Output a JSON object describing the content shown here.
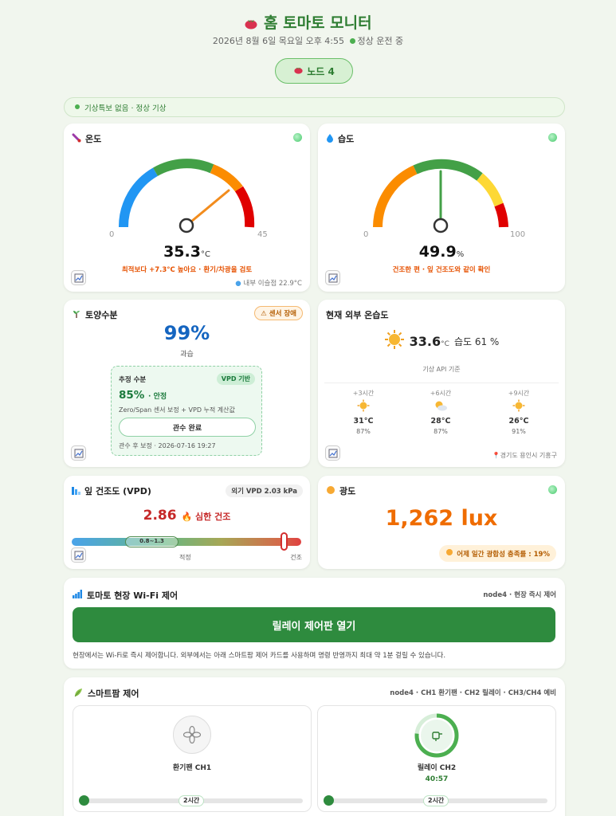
{
  "header": {
    "title": "홈 토마토 모니터",
    "datetime": "2026년 8월 6일 목요일 오후 4:55",
    "status": "정상 운전 중",
    "node_button": "노드 4"
  },
  "alert": {
    "text": "기상특보 없음 · 정상 기상"
  },
  "temperature": {
    "title": "온도",
    "value": "35.3",
    "unit": "°C",
    "min": "0",
    "max": "45",
    "gauge_fraction": 0.784,
    "note": "최적보다 +7.3°C 높아요 · 환기/차광을 검토",
    "dewpoint": "내부 이슬점 22.9°C"
  },
  "humidity": {
    "title": "습도",
    "value": "49.9",
    "unit": "%",
    "min": "0",
    "max": "100",
    "gauge_fraction": 0.499,
    "note": "건조한 편 · 잎 건조도와 같이 확인"
  },
  "soil": {
    "title": "토양수분",
    "badge": "센서 장애",
    "value": "99%",
    "label": "과습",
    "est_title": "추정 수분",
    "est_badge": "VPD 기반",
    "est_value": "85%",
    "est_state": "· 안정",
    "est_desc": "Zero/Span 센서 보정 + VPD 누적 계산값",
    "est_button": "관수 완료",
    "est_foot": "관수 후 보정 · 2026-07-16 19:27"
  },
  "weather": {
    "title": "현재 외부 온습도",
    "temp": "33.6",
    "unit": "°C",
    "humidity": "습도 61 %",
    "source": "기상 API 기준",
    "forecast": [
      {
        "hour": "+3시간",
        "temp": "31°C",
        "hum": "87%",
        "icon": "sun-icon"
      },
      {
        "hour": "+6시간",
        "temp": "28°C",
        "hum": "87%",
        "icon": "partly-cloudy-icon"
      },
      {
        "hour": "+9시간",
        "temp": "26°C",
        "hum": "91%",
        "icon": "sun-icon"
      }
    ],
    "location": "경기도 용인시 기흥구"
  },
  "vpd": {
    "title": "잎 건조도 (VPD)",
    "external": "외기 VPD 2.03 kPa",
    "value": "2.86",
    "state": "심한 건조",
    "range_label": "0.8~1.3",
    "label_optimal": "적정",
    "label_dry": "건조",
    "marker_fraction": 0.95
  },
  "light": {
    "title": "광도",
    "value": "1,262 lux",
    "badge": "어제 일간 광합성 충족률 : 19%"
  },
  "wifi": {
    "title": "토마토 현장 Wi-Fi 제어",
    "meta": "node4 · 현장 즉시 제어",
    "button": "릴레이 제어판 열기",
    "note": "현장에서는 Wi-Fi로 즉시 제어합니다. 외부에서는 아래 스마트팜 제어 카드를 사용하며 명령 반영까지 최대 약 1분 걸릴 수 있습니다."
  },
  "smartfarm": {
    "title": "스마트팜 제어",
    "meta": "node4 · CH1 환기팬 · CH2 릴레이 · CH3/CH4 예비",
    "devices": [
      {
        "name": "환기팬 CH1",
        "time": "",
        "slider": "2시간"
      },
      {
        "name": "릴레이 CH2",
        "time": "40:57",
        "slider": "2시간"
      }
    ]
  },
  "colors": {
    "accent": "#2e7d32",
    "button": "#2e8b3e",
    "warning": "#e65100",
    "danger": "#c62828"
  }
}
